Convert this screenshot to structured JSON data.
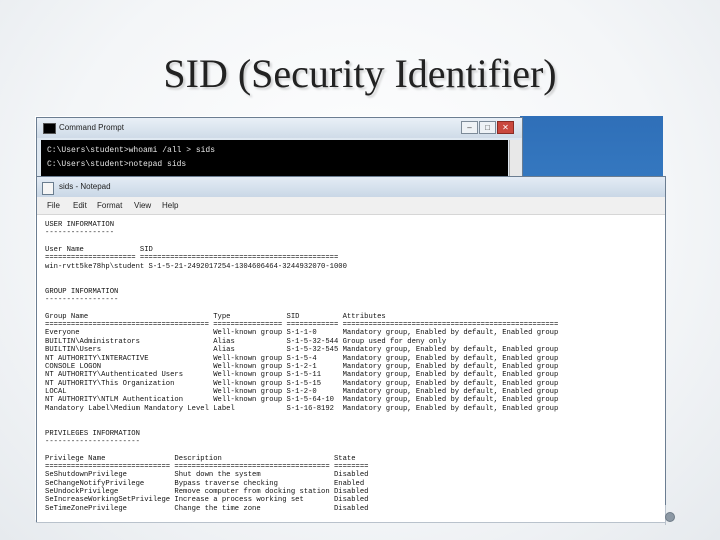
{
  "slide": {
    "title": "SID (Security Identifier)"
  },
  "cmd": {
    "title": "Command Prompt",
    "lines": [
      "C:\\Users\\student>whoami /all > sids",
      "C:\\Users\\student>notepad sids"
    ],
    "buttons": [
      "–",
      "□",
      "✕"
    ]
  },
  "notepad": {
    "title": "sids - Notepad",
    "menu": [
      "File",
      "Edit",
      "Format",
      "View",
      "Help"
    ],
    "lines": [
      "USER INFORMATION",
      "----------------",
      "",
      "User Name             SID",
      "===================== ==============================================",
      "win-rvtt5ke78hp\\student S-1-5-21-2492017254-1304606464-3244932070-1000",
      "",
      "",
      "GROUP INFORMATION",
      "-----------------",
      "",
      "Group Name                             Type             SID          Attributes",
      "====================================== ================ ============ ==================================================",
      "Everyone                               Well-known group S-1-1-0      Mandatory group, Enabled by default, Enabled group",
      "BUILTIN\\Administrators                 Alias            S-1-5-32-544 Group used for deny only",
      "BUILTIN\\Users                          Alias            S-1-5-32-545 Mandatory group, Enabled by default, Enabled group",
      "NT AUTHORITY\\INTERACTIVE               Well-known group S-1-5-4      Mandatory group, Enabled by default, Enabled group",
      "CONSOLE LOGON                          Well-known group S-1-2-1      Mandatory group, Enabled by default, Enabled group",
      "NT AUTHORITY\\Authenticated Users       Well-known group S-1-5-11     Mandatory group, Enabled by default, Enabled group",
      "NT AUTHORITY\\This Organization         Well-known group S-1-5-15     Mandatory group, Enabled by default, Enabled group",
      "LOCAL                                  Well-known group S-1-2-0      Mandatory group, Enabled by default, Enabled group",
      "NT AUTHORITY\\NTLM Authentication       Well-known group S-1-5-64-10  Mandatory group, Enabled by default, Enabled group",
      "Mandatory Label\\Medium Mandatory Level Label            S-1-16-8192  Mandatory group, Enabled by default, Enabled group",
      "",
      "",
      "PRIVILEGES INFORMATION",
      "----------------------",
      "",
      "Privilege Name                Description                          State",
      "============================= ==================================== ========",
      "SeShutdownPrivilege           Shut down the system                 Disabled",
      "SeChangeNotifyPrivilege       Bypass traverse checking             Enabled",
      "SeUndockPrivilege             Remove computer from docking station Disabled",
      "SeIncreaseWorkingSetPrivilege Increase a process working set       Disabled",
      "SeTimeZonePrivilege           Change the time zone                 Disabled"
    ]
  }
}
